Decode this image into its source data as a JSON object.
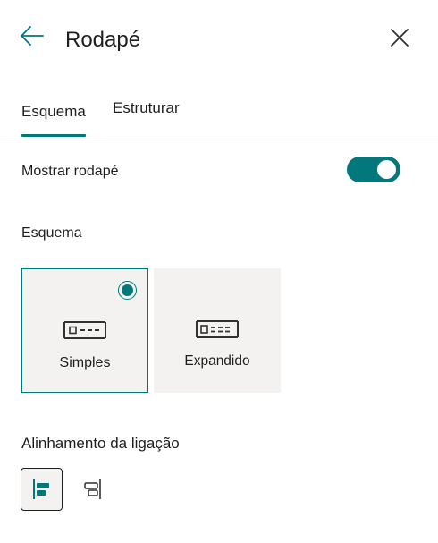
{
  "header": {
    "title": "Rodapé",
    "back_icon": "arrow-left-icon",
    "close_icon": "close-icon"
  },
  "tabs": [
    {
      "label": "Esquema",
      "active": true
    },
    {
      "label": "Estruturar",
      "active": false
    }
  ],
  "show_footer": {
    "label": "Mostrar rodapé",
    "enabled": true
  },
  "layout": {
    "label": "Esquema",
    "options": [
      {
        "label": "Simples",
        "selected": true,
        "icon": "footer-simple-icon"
      },
      {
        "label": "Expandido",
        "selected": false,
        "icon": "footer-extended-icon"
      }
    ]
  },
  "link_alignment": {
    "label": "Alinhamento da ligação",
    "options": [
      {
        "icon": "align-left-icon",
        "selected": true
      },
      {
        "icon": "align-right-icon",
        "selected": false
      }
    ]
  },
  "colors": {
    "accent": "#03787c",
    "text": "#201f1e",
    "card_bg": "#f3f2f1",
    "divider": "#edebe9"
  }
}
